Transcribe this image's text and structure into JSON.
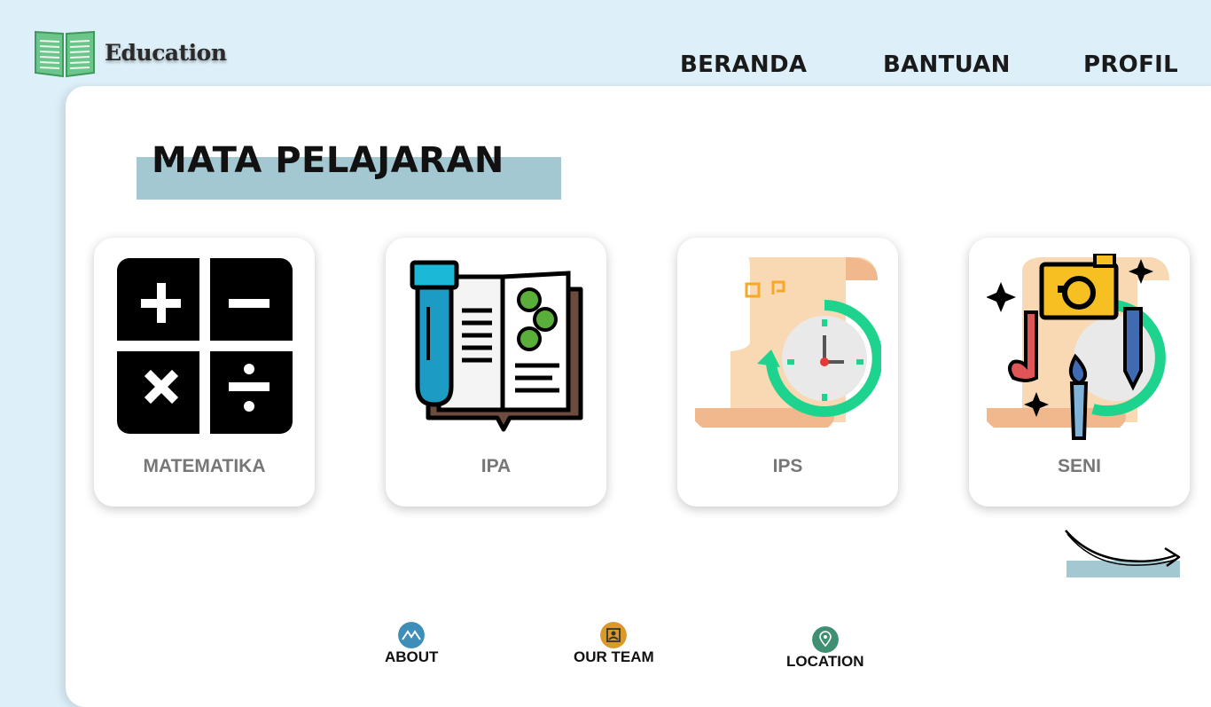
{
  "brand": {
    "name": "Education"
  },
  "nav": {
    "items": [
      {
        "label": "BERANDA"
      },
      {
        "label": "BANTUAN"
      },
      {
        "label": "PROFIL"
      }
    ]
  },
  "main": {
    "title": "MATA PELAJARAN",
    "subjects": [
      {
        "label": "MATEMATIKA",
        "icon": "math-operators-icon"
      },
      {
        "label": "IPA",
        "icon": "science-book-icon"
      },
      {
        "label": "IPS",
        "icon": "history-scroll-clock-icon"
      },
      {
        "label": "SENI",
        "icon": "art-tools-icon"
      }
    ],
    "next_icon": "curved-arrow-right-icon"
  },
  "footer": {
    "items": [
      {
        "label": "ABOUT",
        "icon": "mountain-icon",
        "color": "#3d8fb8"
      },
      {
        "label": "OUR TEAM",
        "icon": "team-card-icon",
        "color": "#d99a2b"
      },
      {
        "label": "LOCATION",
        "icon": "map-pin-icon",
        "color": "#3f8f72"
      }
    ]
  },
  "colors": {
    "background": "#ddeff9",
    "accent_bar": "#a3c8d2",
    "panel": "#ffffff"
  }
}
